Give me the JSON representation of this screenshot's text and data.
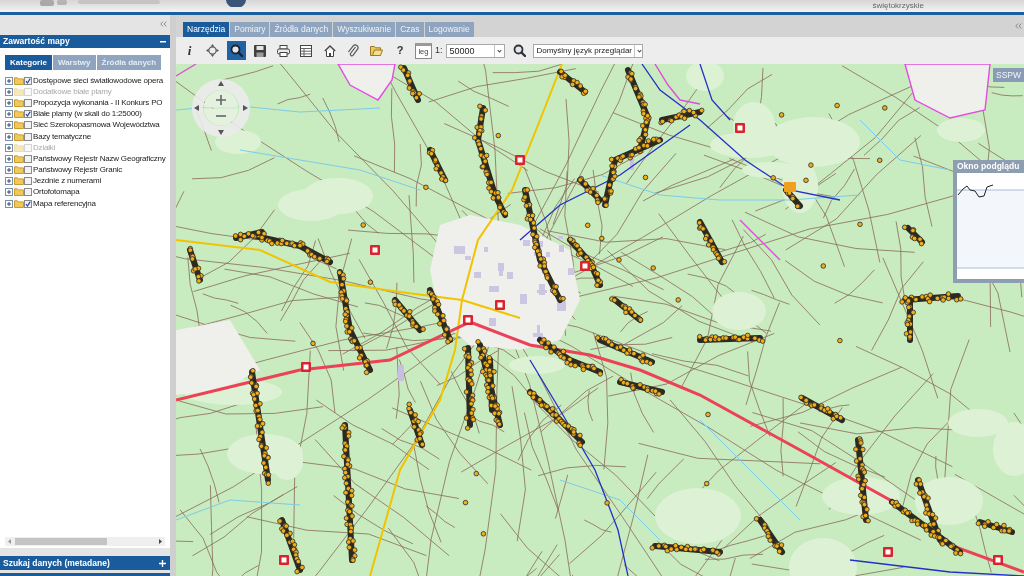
{
  "header": {
    "region_label": "świętokrzyskie"
  },
  "left_panel": {
    "sections": [
      {
        "title": "Zawartość mapy",
        "expanded": true
      },
      {
        "title": "Szukaj danych (metadane)",
        "expanded": false
      }
    ],
    "tabs": [
      {
        "label": "Kategorie",
        "selected": true
      },
      {
        "label": "Warstwy",
        "selected": false
      },
      {
        "label": "Źródła danych",
        "selected": false
      }
    ],
    "layers": [
      {
        "label": "Dostępowe sieci światłowodowe opera",
        "checked": true,
        "disabled": false,
        "expanded": false
      },
      {
        "label": "Dodatkowe białe plamy",
        "checked": false,
        "disabled": true,
        "expanded": false
      },
      {
        "label": "Propozycja wykonania - II Konkurs PO",
        "checked": false,
        "disabled": false,
        "expanded": false
      },
      {
        "label": "Białe plamy (w skali do 1:25000)",
        "checked": true,
        "disabled": false,
        "expanded": false
      },
      {
        "label": "Sieć Szerokopasmowa Województwa",
        "checked": false,
        "disabled": false,
        "expanded": false
      },
      {
        "label": "Bazy tematyczne",
        "checked": false,
        "disabled": false,
        "expanded": false
      },
      {
        "label": "Działki",
        "checked": false,
        "disabled": true,
        "expanded": false
      },
      {
        "label": "Państwowy Rejestr Nazw Geograficzny",
        "checked": false,
        "disabled": false,
        "expanded": false
      },
      {
        "label": "Państwowy Rejestr Granic",
        "checked": false,
        "disabled": false,
        "expanded": false
      },
      {
        "label": "Jezdnie z numerami",
        "checked": false,
        "disabled": false,
        "expanded": false
      },
      {
        "label": "Ortofotomapa",
        "checked": false,
        "disabled": false,
        "expanded": false
      },
      {
        "label": "Mapa referencyjna",
        "checked": true,
        "disabled": false,
        "expanded": false
      }
    ]
  },
  "toolbar": {
    "tabs": [
      {
        "label": "Narzędzia",
        "selected": true
      },
      {
        "label": "Pomiary",
        "selected": false
      },
      {
        "label": "Źródła danych",
        "selected": false
      },
      {
        "label": "Wyszukiwanie",
        "selected": false
      },
      {
        "label": "Czas",
        "selected": false
      },
      {
        "label": "Logowanie",
        "selected": false
      }
    ],
    "tools": [
      {
        "kind": "info",
        "label": "i",
        "selected": false
      },
      {
        "kind": "pan",
        "selected": false
      },
      {
        "kind": "zoom_box",
        "selected": true
      },
      {
        "kind": "save",
        "selected": false
      },
      {
        "kind": "print",
        "selected": false
      },
      {
        "kind": "table",
        "selected": false
      },
      {
        "kind": "home",
        "selected": false
      },
      {
        "kind": "attach",
        "selected": false
      },
      {
        "kind": "open",
        "selected": false
      },
      {
        "kind": "help",
        "label": "?",
        "selected": false
      },
      {
        "kind": "legend",
        "label": "leg",
        "selected": false
      }
    ],
    "scale_prefix": "1:",
    "scale": "50000",
    "language": "Domyślny język przeglądar"
  },
  "map": {
    "layer_button": "SSPW",
    "overview_title": "Okno podglądu"
  }
}
